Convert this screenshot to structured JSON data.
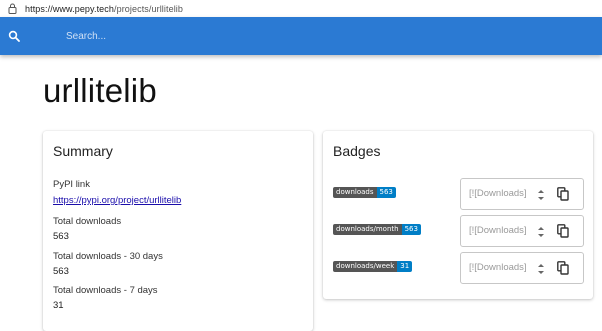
{
  "browser": {
    "url_host": "https://www.pepy.tech",
    "url_path": "/projects/urllitelib"
  },
  "header": {
    "search_placeholder": "Search..."
  },
  "page": {
    "title": "urllitelib"
  },
  "summary": {
    "title": "Summary",
    "pypi_label": "PyPI link",
    "pypi_link": "https://pypi.org/project/urllitelib",
    "total_label": "Total downloads",
    "total_value": "563",
    "d30_label": "Total downloads - 30 days",
    "d30_value": "563",
    "d7_label": "Total downloads - 7 days",
    "d7_value": "31"
  },
  "badges": {
    "title": "Badges",
    "items": [
      {
        "label": "downloads",
        "value": "563",
        "field_placeholder": "[![Downloads]"
      },
      {
        "label": "downloads/month",
        "value": "563",
        "field_placeholder": "[![Downloads]"
      },
      {
        "label": "downloads/week",
        "value": "31",
        "field_placeholder": "[![Downloads]"
      }
    ]
  },
  "colors": {
    "header_blue": "#2b7ad3",
    "badge_left": "#555555",
    "badge_right": "#007ec6",
    "link": "#1a0dab"
  },
  "icons": [
    "lock-icon",
    "search-icon",
    "stepper-icon",
    "copy-icon"
  ]
}
